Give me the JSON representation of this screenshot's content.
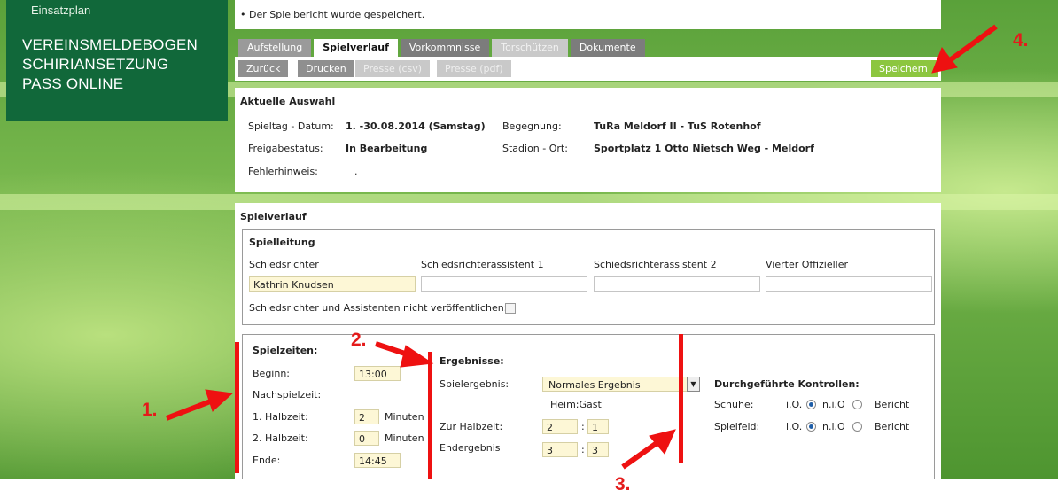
{
  "sidebar": {
    "top_link": "Einsatzplan",
    "items": [
      "VEREINSMELDEBOGEN",
      "SCHIRIANSETZUNG",
      "PASS ONLINE"
    ]
  },
  "notice": "Der Spielbericht wurde gespeichert.",
  "tabs": [
    {
      "label": "Aufstellung",
      "state": "normal"
    },
    {
      "label": "Spielverlauf",
      "state": "active"
    },
    {
      "label": "Vorkommnisse",
      "state": "dark"
    },
    {
      "label": "Torschützen",
      "state": "disabled"
    },
    {
      "label": "Dokumente",
      "state": "dark"
    }
  ],
  "toolbar": {
    "back": "Zurück",
    "print": "Drucken",
    "press_csv": "Presse (csv)",
    "press_pdf": "Presse (pdf)",
    "save": "Speichern"
  },
  "selection": {
    "title": "Aktuelle Auswahl",
    "matchday_label": "Spieltag - Datum:",
    "matchday_value": "1. -30.08.2014 (Samstag)",
    "encounter_label": "Begegnung:",
    "encounter_value": "TuRa Meldorf II - TuS Rotenhof",
    "release_label": "Freigabestatus:",
    "release_value": "In Bearbeitung",
    "stadium_label": "Stadion - Ort:",
    "stadium_value": "Sportplatz 1 Otto Nietsch Weg - Meldorf",
    "error_label": "Fehlerhinweis:",
    "error_value": "."
  },
  "course": {
    "title": "Spielverlauf",
    "officials": {
      "title": "Spielleitung",
      "referee_label": "Schiedsrichter",
      "assistant1_label": "Schiedsrichterassistent 1",
      "assistant2_label": "Schiedsrichterassistent 2",
      "fourth_label": "Vierter Offizieller",
      "referee_value": "Kathrin Knudsen",
      "assistant1_value": "",
      "assistant2_value": "",
      "fourth_value": "",
      "hide_label": "Schiedsrichter und Assistenten nicht veröffentlichen:"
    },
    "times": {
      "title": "Spielzeiten:",
      "start_label": "Beginn:",
      "start_value": "13:00",
      "extra_label": "Nachspielzeit:",
      "half1_label": "1. Halbzeit:",
      "half1_value": "2",
      "half2_label": "2. Halbzeit:",
      "half2_value": "0",
      "minutes": "Minuten",
      "end_label": "Ende:",
      "end_value": "14:45"
    },
    "results": {
      "title": "Ergebnisse:",
      "type_label": "Spielergebnis:",
      "type_value": "Normales Ergebnis",
      "home_guest": "Heim:Gast",
      "halftime_label": "Zur Halbzeit:",
      "halftime_home": "2",
      "halftime_guest": "1",
      "final_label": "Endergebnis",
      "final_home": "3",
      "final_guest": "3",
      "colon": ":"
    },
    "controls": {
      "title": "Durchgeführte Kontrollen:",
      "shoes_label": "Schuhe:",
      "field_label": "Spielfeld:",
      "opt_io": "i.O.",
      "opt_nio": "n.i.O",
      "opt_report": "Bericht"
    }
  },
  "annotations": {
    "n1": "1.",
    "n2": "2.",
    "n3": "3.",
    "n4": "4.",
    "color": "#e41b1b"
  }
}
